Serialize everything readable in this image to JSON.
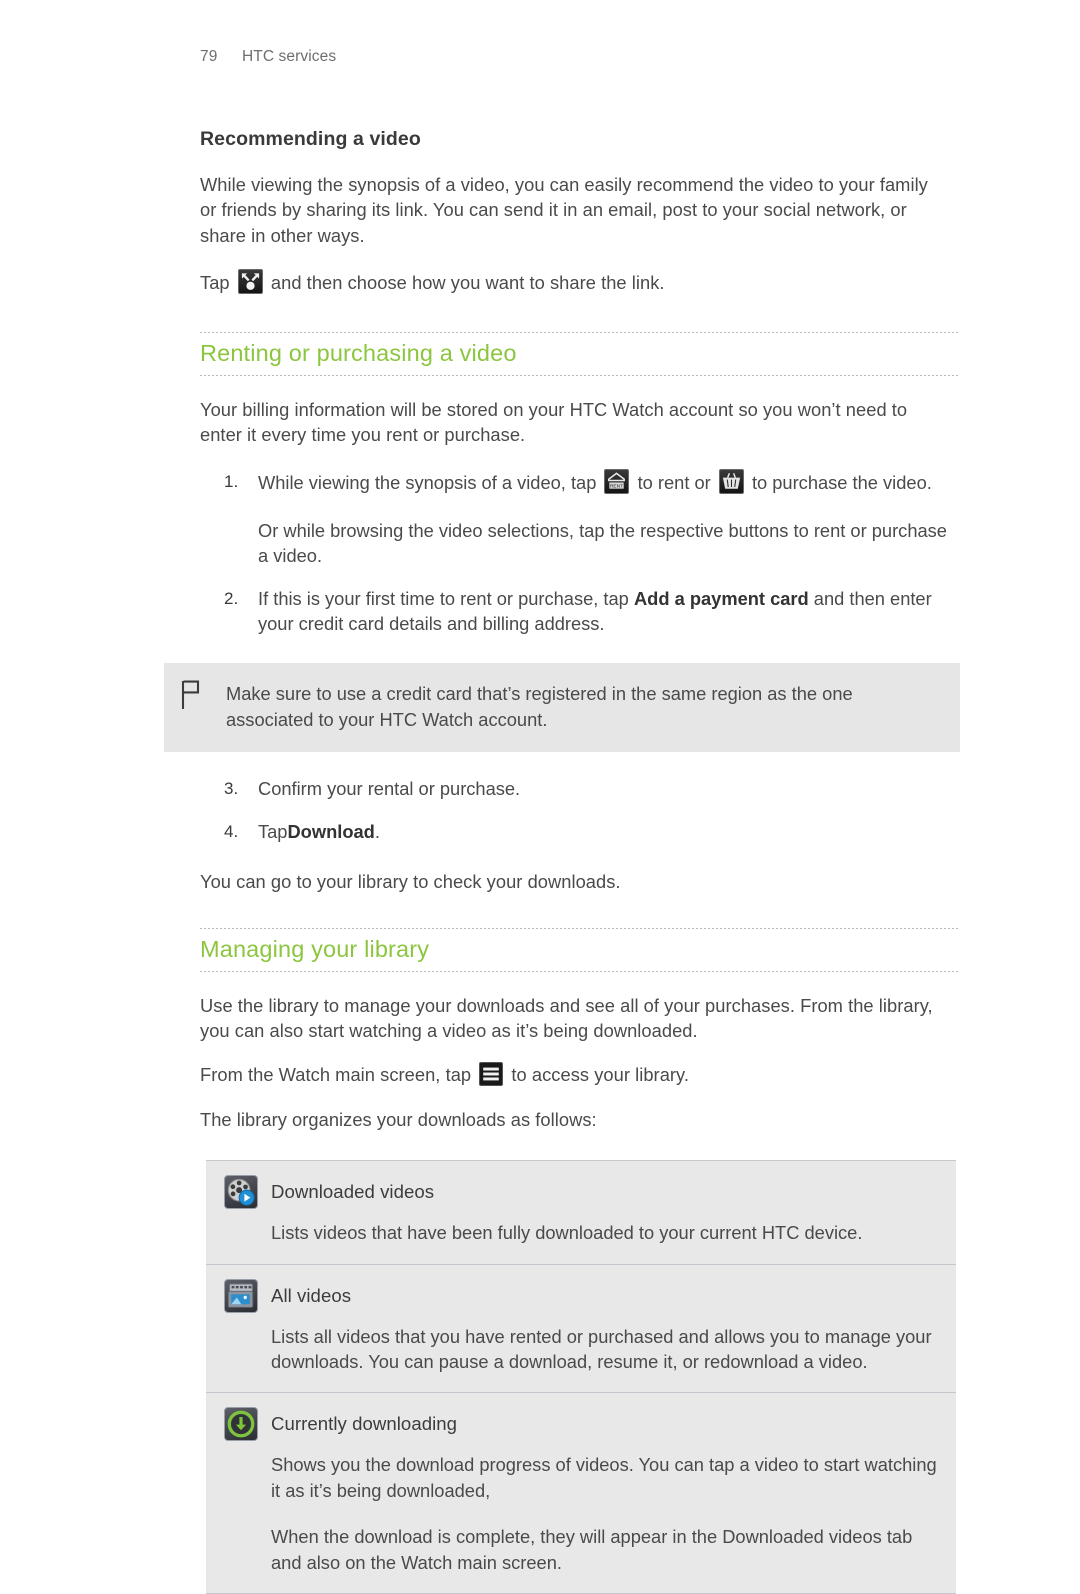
{
  "header": {
    "page_number": "79",
    "chapter": "HTC services"
  },
  "sections": {
    "recommending": {
      "heading": "Recommending a video",
      "paragraph_1": "While viewing the synopsis of a video, you can easily recommend the video to your family or friends by sharing its link. You can send it in an email, post to your social network, or share in other ways.",
      "tap_prefix": "Tap",
      "tap_suffix": "and then choose how you want to share the link.",
      "share_icon_name": "share-icon"
    },
    "renting": {
      "heading": "Renting or purchasing a video",
      "intro": "Your billing information will be stored on your HTC Watch account so you won’t need to enter it every time you rent or purchase.",
      "steps": [
        {
          "number": "1.",
          "text_before_rent_icon": "While viewing the synopsis of a video, tap",
          "text_between_icons": "to rent or",
          "text_after_basket_icon": "to purchase the video.",
          "sub_paragraph": "Or while browsing the video selections, tap the respective buttons to rent or purchase a video.",
          "rent_icon_name": "rent-tag-icon",
          "purchase_icon_name": "shopping-basket-icon"
        },
        {
          "number": "2.",
          "text_before_bold": "If this is your first time to rent or purchase, tap",
          "bold_label": "Add a payment card",
          "text_after_bold": "and then enter your credit card details and billing address."
        },
        {
          "number": "3.",
          "text": "Confirm your rental or purchase."
        },
        {
          "number": "4.",
          "text_before_bold": "Tap",
          "bold_label": "Download",
          "text_after_bold": "."
        }
      ],
      "note": {
        "icon_name": "flag-icon",
        "text": "Make sure to use a credit card that’s registered in the same region as the one associated to your HTC Watch account."
      },
      "closing": "You can go to your library to check your downloads."
    },
    "library": {
      "heading": "Managing your library",
      "paragraph_1": "Use the library to manage your downloads and see all of your purchases. From the library, you can also start watching a video as it’s being downloaded.",
      "access_prefix": "From the Watch main screen, tap",
      "access_suffix": "to access your library.",
      "menu_icon_name": "hamburger-menu-icon",
      "list_intro": "The library organizes your downloads as follows:",
      "items": [
        {
          "icon_name": "film-reel-play-icon",
          "title": "Downloaded videos",
          "paragraphs": [
            "Lists videos that have been fully downloaded to your current HTC device."
          ]
        },
        {
          "icon_name": "film-strip-icon",
          "title": "All videos",
          "paragraphs": [
            "Lists all videos that you have rented or purchased and allows you to manage your downloads. You can pause a download, resume it, or redownload a video."
          ]
        },
        {
          "icon_name": "download-circle-icon",
          "title": "Currently downloading",
          "paragraphs": [
            "Shows you the download progress of videos. You can tap a video to start watching it as it’s being downloaded,",
            "When the download is complete, they will appear in the Downloaded videos tab and also on the Watch main screen."
          ]
        }
      ]
    }
  },
  "colors": {
    "heading_green": "#8cc63f",
    "body_text": "#4a4a4a",
    "note_background": "#e6e6e6",
    "table_background": "#e8e8e8"
  }
}
